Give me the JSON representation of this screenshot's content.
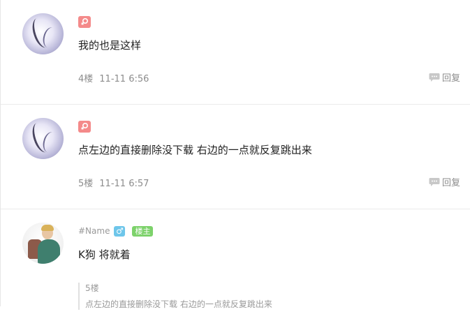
{
  "comments": [
    {
      "gender_icon": "female-icon",
      "text": "我的也是这样",
      "floor": "4楼",
      "time": "11-11 6:56",
      "reply_label": "回复"
    },
    {
      "gender_icon": "female-icon",
      "text": "点左边的直接删除没下载 右边的一点就反复跳出来",
      "floor": "5楼",
      "time": "11-11 6:57",
      "reply_label": "回复"
    },
    {
      "username": "#Name",
      "gender_symbol": "♂",
      "owner_badge": "楼主",
      "text": "K狗  将就着",
      "quote": {
        "floor": "5楼",
        "text": "点左边的直接删除没下载 右边的一点就反复跳出来"
      }
    }
  ],
  "colors": {
    "female_badge": "#f48a8a",
    "male_badge": "#6ec6ea",
    "owner_badge": "#7dd26b",
    "meta_text": "#8c8c8c"
  }
}
